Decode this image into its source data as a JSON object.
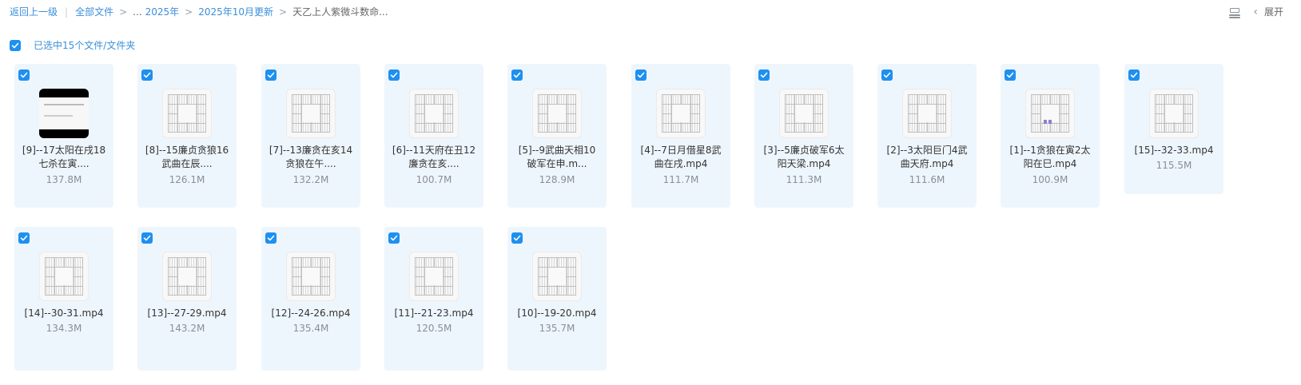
{
  "breadcrumb": {
    "back": "返回上一级",
    "all_files": "全部文件",
    "ellipsis": "...",
    "year": "2025年",
    "month": "2025年10月更新",
    "current": "天乙上人紫微斗数命..."
  },
  "toolbar": {
    "expand_label": "展开"
  },
  "selection": {
    "label": "已选中15个文件/文件夹",
    "checked": true
  },
  "colors": {
    "accent": "#1e90f0",
    "card_bg": "#eef6fd",
    "link": "#3b8fd9"
  },
  "files": [
    {
      "name_line1": "[9]--17太阳在戌18",
      "name_line2": "七杀在寅....",
      "size": "137.8M",
      "thumb": "video-dark"
    },
    {
      "name_line1": "[8]--15廉贞贪狼16",
      "name_line2": "武曲在辰....",
      "size": "126.1M",
      "thumb": "chart"
    },
    {
      "name_line1": "[7]--13廉贪在亥14",
      "name_line2": "贪狼在午....",
      "size": "132.2M",
      "thumb": "chart"
    },
    {
      "name_line1": "[6]--11天府在丑12",
      "name_line2": "廉贪在亥....",
      "size": "100.7M",
      "thumb": "chart"
    },
    {
      "name_line1": "[5]--9武曲天相10",
      "name_line2": "破军在申.m...",
      "size": "128.9M",
      "thumb": "chart"
    },
    {
      "name_line1": "[4]--7日月借星8武",
      "name_line2": "曲在戌.mp4",
      "size": "111.7M",
      "thumb": "chart"
    },
    {
      "name_line1": "[3]--5廉贞破军6太",
      "name_line2": "阳天梁.mp4",
      "size": "111.3M",
      "thumb": "chart"
    },
    {
      "name_line1": "[2]--3太阳巨门4武",
      "name_line2": "曲天府.mp4",
      "size": "111.6M",
      "thumb": "chart"
    },
    {
      "name_line1": "[1]--1贪狼在寅2太",
      "name_line2": "阳在巳.mp4",
      "size": "100.9M",
      "thumb": "chart-marked"
    },
    {
      "name_line1": "[15]--32-33.mp4",
      "name_line2": "",
      "size": "115.5M",
      "thumb": "chart"
    },
    {
      "name_line1": "[14]--30-31.mp4",
      "name_line2": "",
      "size": "134.3M",
      "thumb": "chart"
    },
    {
      "name_line1": "[13]--27-29.mp4",
      "name_line2": "",
      "size": "143.2M",
      "thumb": "chart"
    },
    {
      "name_line1": "[12]--24-26.mp4",
      "name_line2": "",
      "size": "135.4M",
      "thumb": "chart"
    },
    {
      "name_line1": "[11]--21-23.mp4",
      "name_line2": "",
      "size": "120.5M",
      "thumb": "chart"
    },
    {
      "name_line1": "[10]--19-20.mp4",
      "name_line2": "",
      "size": "135.7M",
      "thumb": "chart"
    }
  ]
}
